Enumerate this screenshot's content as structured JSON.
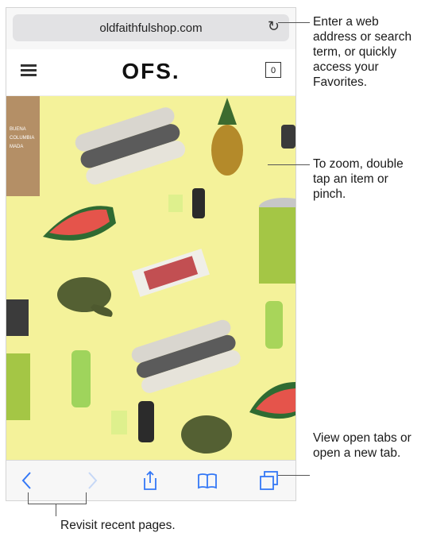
{
  "browser": {
    "url": "oldfaithfulshop.com",
    "reload_icon": "reload-icon"
  },
  "site": {
    "logo": "OFS.",
    "cart_count": "0"
  },
  "toolbar": {
    "icons": [
      "back-icon",
      "forward-icon",
      "share-icon",
      "bookmarks-icon",
      "tabs-icon"
    ]
  },
  "hero_bag_text": "BUENA\nCOLUMBIA\nMADA",
  "callouts": {
    "address": "Enter a web address or search term, or quickly access your Favorites.",
    "zoom": "To zoom, double tap an item or pinch.",
    "tabs": "View open tabs or open a new tab.",
    "revisit": "Revisit recent pages."
  },
  "colors": {
    "accent": "#3478f6",
    "hero_bg": "#f4f29a"
  }
}
